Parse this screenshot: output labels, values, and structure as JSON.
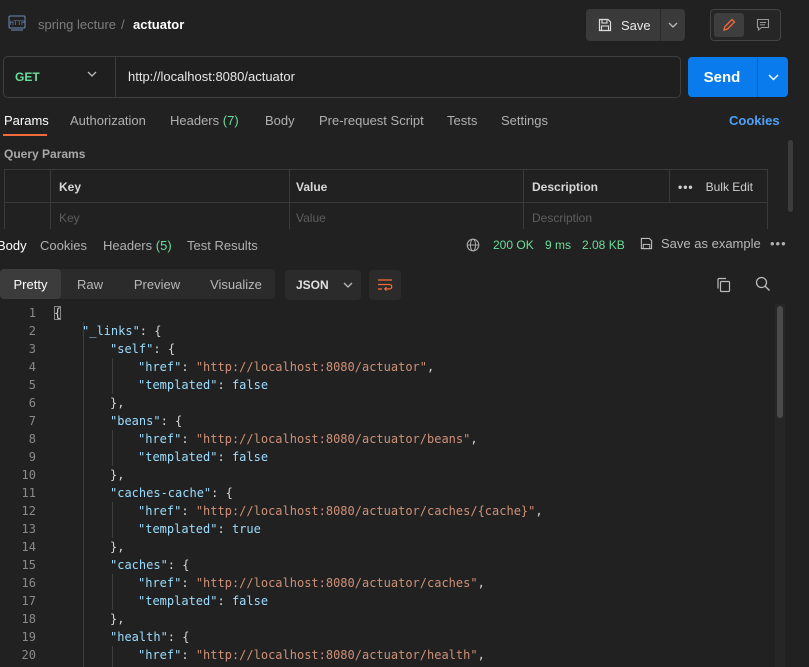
{
  "breadcrumb": {
    "parent": "spring lecture",
    "separator": "/",
    "current": "actuator"
  },
  "header": {
    "save_label": "Save"
  },
  "request": {
    "method": "GET",
    "url": "http://localhost:8080/actuator",
    "send_label": "Send"
  },
  "request_tabs": {
    "params": "Params",
    "authorization": "Authorization",
    "headers": "Headers",
    "headers_count": "(7)",
    "body": "Body",
    "prerequest": "Pre-request Script",
    "tests": "Tests",
    "settings": "Settings",
    "cookies": "Cookies"
  },
  "query_params": {
    "title": "Query Params",
    "columns": {
      "key": "Key",
      "value": "Value",
      "description": "Description"
    },
    "placeholders": {
      "key": "Key",
      "value": "Value",
      "description": "Description"
    },
    "bulk_edit": "Bulk Edit"
  },
  "response_tabs": {
    "body": "Body",
    "cookies": "Cookies",
    "headers": "Headers",
    "headers_count": "(5)",
    "test_results": "Test Results"
  },
  "response_status": {
    "code": "200 OK",
    "time": "9 ms",
    "size": "2.08 KB",
    "save_example": "Save as example"
  },
  "view": {
    "modes": [
      "Pretty",
      "Raw",
      "Preview",
      "Visualize"
    ],
    "active_mode": "Pretty",
    "format": "JSON"
  },
  "code": {
    "line_numbers": [
      "1",
      "2",
      "3",
      "4",
      "5",
      "6",
      "7",
      "8",
      "9",
      "10",
      "11",
      "12",
      "13",
      "14",
      "15",
      "16",
      "17",
      "18",
      "19",
      "20"
    ],
    "lines": [
      "{",
      "\"_links\": {",
      "\"self\": {",
      "\"href\": \"http://localhost:8080/actuator\",",
      "\"templated\": false",
      "},",
      "\"beans\": {",
      "\"href\": \"http://localhost:8080/actuator/beans\",",
      "\"templated\": false",
      "},",
      "\"caches-cache\": {",
      "\"href\": \"http://localhost:8080/actuator/caches/{cache}\",",
      "\"templated\": true",
      "},",
      "\"caches\": {",
      "\"href\": \"http://localhost:8080/actuator/caches\",",
      "\"templated\": false",
      "},",
      "\"health\": {",
      "\"href\": \"http://localhost:8080/actuator/health\","
    ]
  },
  "colors": {
    "accent_orange": "#f26b3a",
    "send_blue": "#097bed",
    "status_green": "#6bdd9a",
    "link_blue": "#4ea1f6"
  },
  "icons": [
    "http-icon",
    "save-icon",
    "chevron-down-icon",
    "pencil-icon",
    "comment-icon",
    "globe-icon",
    "copy-icon",
    "search-icon",
    "wrap-icon",
    "more-icon"
  ]
}
